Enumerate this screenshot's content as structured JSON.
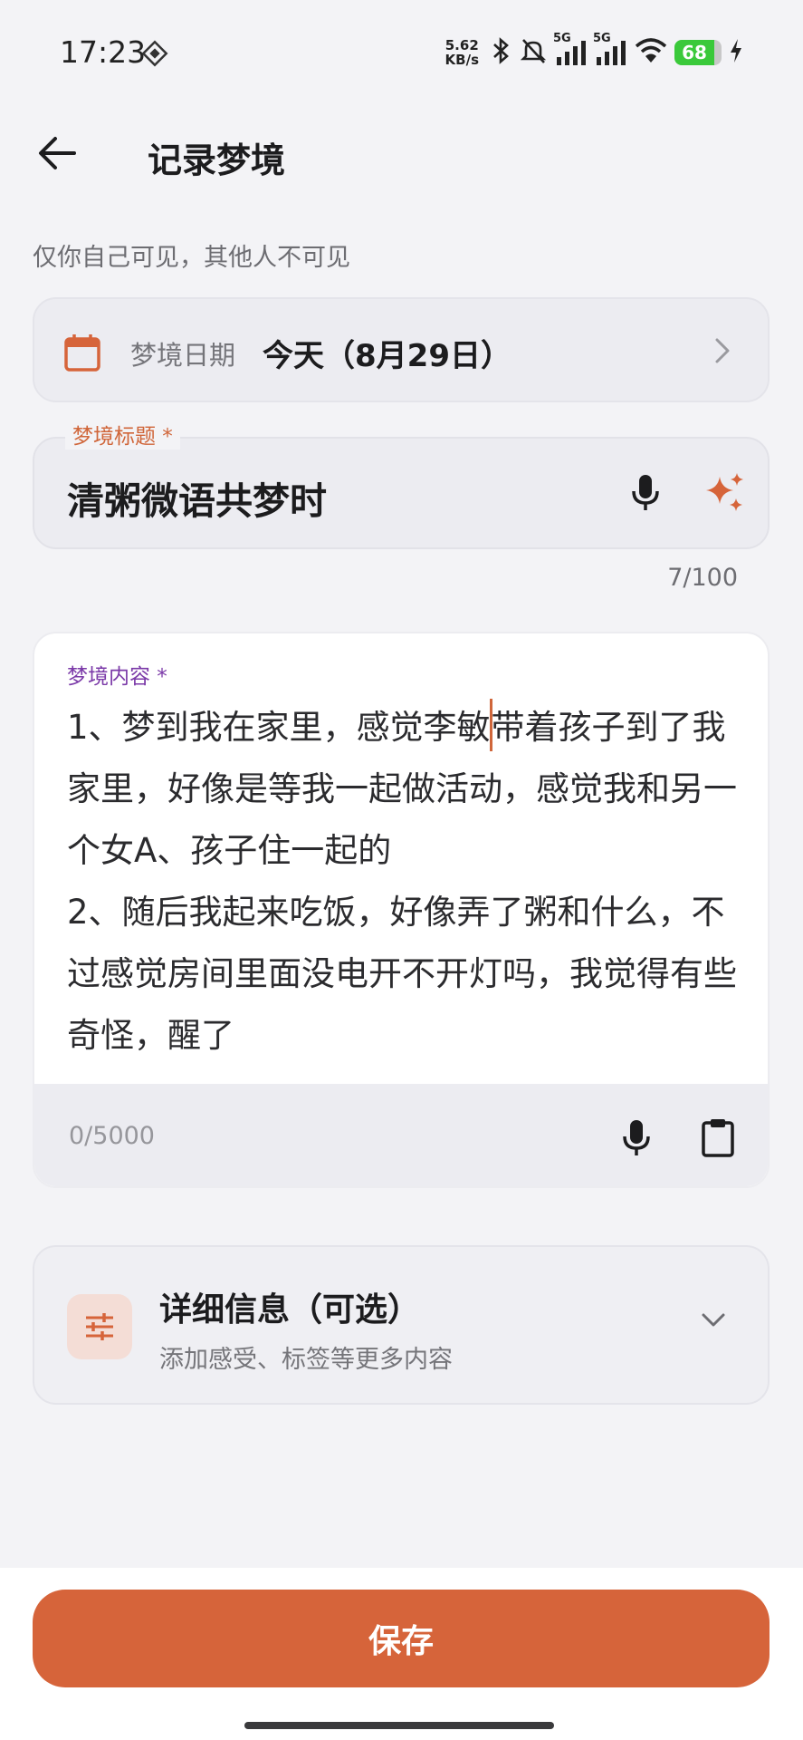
{
  "status_bar": {
    "time": "17:23",
    "net_speed_value": "5.62",
    "net_speed_unit": "KB/s",
    "signal1_label": "5G",
    "signal2_label": "5G",
    "battery": "68"
  },
  "header": {
    "title": "记录梦境"
  },
  "privacy_note": "仅你自己可见，其他人不可见",
  "date_field": {
    "label": "梦境日期",
    "value": "今天（8月29日）"
  },
  "title_field": {
    "label": "梦境标题 *",
    "value": "清粥微语共梦时",
    "count": "7/100"
  },
  "content_field": {
    "label": "梦境内容 *",
    "text_before_cursor": "1、梦到我在家里，感觉李敏",
    "text_after_cursor": "带着孩子到了我家里，好像是等我一起做活动，感觉我和另一个女A、孩子住一起的\n2、随后我起来吃饭，好像弄了粥和什么，不过感觉房间里面没电开不开灯吗，我觉得有些奇怪，醒了",
    "count": "0/5000"
  },
  "details": {
    "title": "详细信息（可选）",
    "subtitle": "添加感受、标签等更多内容"
  },
  "save_label": "保存",
  "colors": {
    "accent": "#d6643a",
    "content_label": "#7b3aa8",
    "background": "#f3f3f6"
  }
}
